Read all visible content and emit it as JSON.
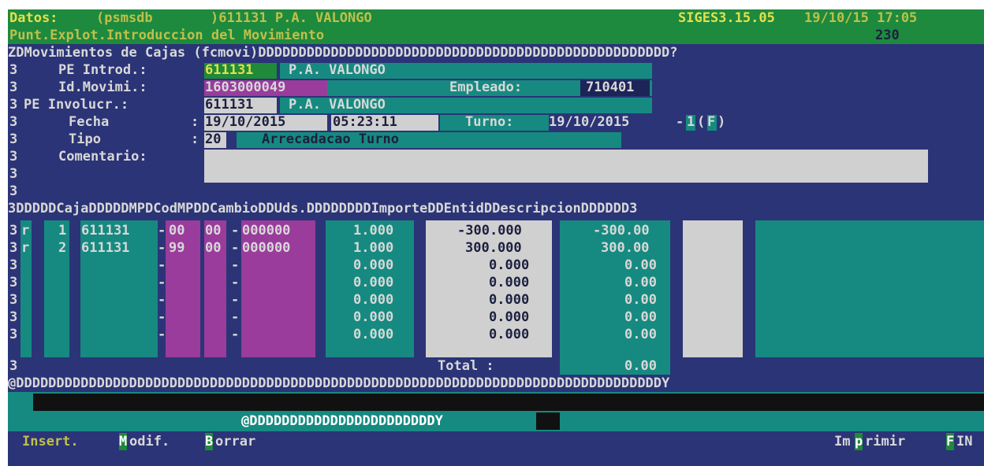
{
  "header": {
    "datos_label": "Datos:",
    "schema": "(psmsdb",
    "station": ")611131 P.A. VALONGO",
    "version": "SIGES3.15.05",
    "datetime": "19/10/15 17:05",
    "subtitle": "Punt.Explot.Introduccion del Movimiento",
    "code": "230"
  },
  "frame": {
    "top": "ZDMovimientos de Cajas (fcmovi)DDDDDDDDDDDDDDDDDDDDDDDDDDDDDDDDDDDDDDDDDDDDDDDDDDD?",
    "side": "3",
    "grid_header": "3DDDDDCajaDDDDDMPDCodMPDDCambioDDUds.DDDDDDDDImporteDDEntidDDescripcionDDDDDD3",
    "bottom": "@DDDDDDDDDDDDDDDDDDDDDDDDDDDDDDDDDDDDDDDDDDDDDDDDDDDDDDDDDDDDDDDDDDDDDDDDDDDDDDDDY",
    "popup_border": "@DDDDDDDDDDDDDDDDDDDDDDDY"
  },
  "form": {
    "pe_introd": {
      "label": "PE Introd.:",
      "code": "611131",
      "name": "P.A. VALONGO"
    },
    "id_movimi": {
      "label": "Id.Movimi.:",
      "value": "1603000049"
    },
    "empleado": {
      "label": "Empleado:",
      "value": "710401"
    },
    "pe_involucr": {
      "label": "PE Involucr.:",
      "code": "611131",
      "name": "P.A. VALONGO"
    },
    "fecha": {
      "label": "Fecha",
      "colon": ":",
      "date": "19/10/2015",
      "time": "05:23:11"
    },
    "turno": {
      "label": "Turno:",
      "date": "19/10/2015",
      "dash": "-",
      "num": "1",
      "open": "(",
      "flag": "F",
      "close": ")"
    },
    "tipo": {
      "label": "Tipo",
      "colon": ":",
      "code": "20",
      "desc": "Arrecadacao Turno"
    },
    "comentario": {
      "label": "Comentario:",
      "value": ""
    }
  },
  "rows": [
    {
      "mark": "r",
      "n": "1",
      "caja": "611131",
      "mp": "00",
      "codmp1": "00",
      "codmp2": "000000",
      "cambio": "1.000",
      "uds": "-300.000",
      "importe": "-300.00"
    },
    {
      "mark": "r",
      "n": "2",
      "caja": "611131",
      "mp": "99",
      "codmp1": "00",
      "codmp2": "000000",
      "cambio": "1.000",
      "uds": "300.000",
      "importe": "300.00"
    },
    {
      "mark": "",
      "n": "",
      "caja": "",
      "mp": "",
      "codmp1": "",
      "codmp2": "",
      "cambio": "0.000",
      "uds": "0.000",
      "importe": "0.00"
    },
    {
      "mark": "",
      "n": "",
      "caja": "",
      "mp": "",
      "codmp1": "",
      "codmp2": "",
      "cambio": "0.000",
      "uds": "0.000",
      "importe": "0.00"
    },
    {
      "mark": "",
      "n": "",
      "caja": "",
      "mp": "",
      "codmp1": "",
      "codmp2": "",
      "cambio": "0.000",
      "uds": "0.000",
      "importe": "0.00"
    },
    {
      "mark": "",
      "n": "",
      "caja": "",
      "mp": "",
      "codmp1": "",
      "codmp2": "",
      "cambio": "0.000",
      "uds": "0.000",
      "importe": "0.00"
    },
    {
      "mark": "",
      "n": "",
      "caja": "",
      "mp": "",
      "codmp1": "",
      "codmp2": "",
      "cambio": "0.000",
      "uds": "0.000",
      "importe": "0.00"
    }
  ],
  "total": {
    "label": "Total :",
    "value": "0.00"
  },
  "menu": {
    "insert": "Insert.",
    "modif_key": "M",
    "modif_rest": "odif.",
    "borrar_key": "B",
    "borrar_rest": "orrar",
    "imprimir_a": "Im",
    "imprimir_key": "p",
    "imprimir_b": "rimir",
    "fin_key": "F",
    "fin_rest": "IN"
  },
  "colors": {
    "screen_bg": "#2b3476",
    "title_bar": "#1d8a3e",
    "frame_text": "#d8d8d8",
    "field_teal": "#168a80",
    "field_grey": "#d0d0d0",
    "field_magenta": "#9a3c9c",
    "field_green": "#1e8a3a",
    "label_yellow": "#e5e04a"
  }
}
